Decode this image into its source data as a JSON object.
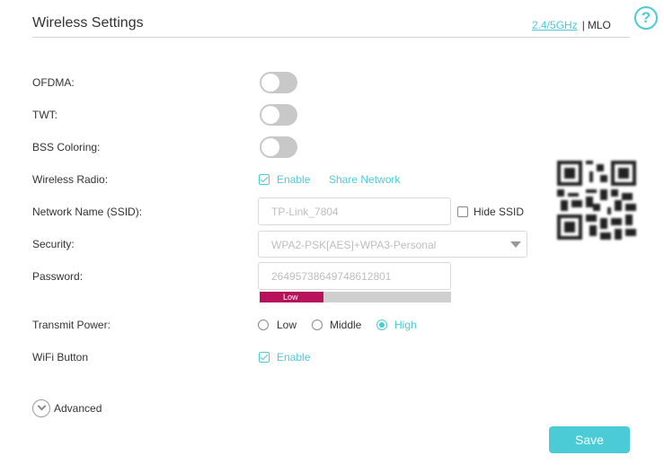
{
  "header": {
    "title": "Wireless Settings",
    "band_link": "2.4/5GHz",
    "separator": "|",
    "mlo_label": "MLO",
    "help_icon": "?"
  },
  "labels": {
    "ofdma": "OFDMA:",
    "twt": "TWT:",
    "bss_coloring": "BSS Coloring:",
    "wireless_radio": "Wireless Radio:",
    "network_name": "Network Name (SSID):",
    "security": "Security:",
    "password": "Password:",
    "transmit_power": "Transmit Power:",
    "wifi_button": "WiFi Button"
  },
  "toggles": {
    "ofdma": false,
    "twt": false,
    "bss_coloring": false
  },
  "wireless_radio": {
    "checked": true,
    "enable_label": "Enable",
    "share_link": "Share Network"
  },
  "ssid": {
    "value": "TP-Link_7804",
    "hide_label": "Hide SSID",
    "hide_checked": false
  },
  "security": {
    "selected": "WPA2-PSK[AES]+WPA3-Personal"
  },
  "password": {
    "value": "26495738649748612801",
    "strength_label": "Low",
    "strength_fraction": 0.333
  },
  "transmit_power": {
    "options": [
      "Low",
      "Middle",
      "High"
    ],
    "selected": "High"
  },
  "wifi_button": {
    "checked": true,
    "enable_label": "Enable"
  },
  "advanced": {
    "label": "Advanced"
  },
  "actions": {
    "save": "Save"
  },
  "colors": {
    "accent": "#4acbd6",
    "strength_low": "#b6135c",
    "toggle_off": "#c8c8c8"
  },
  "icons": {
    "help": "question-circle-icon",
    "advanced": "chevron-down-circle-icon",
    "select": "caret-down-icon",
    "qr": "qr-code-icon"
  }
}
